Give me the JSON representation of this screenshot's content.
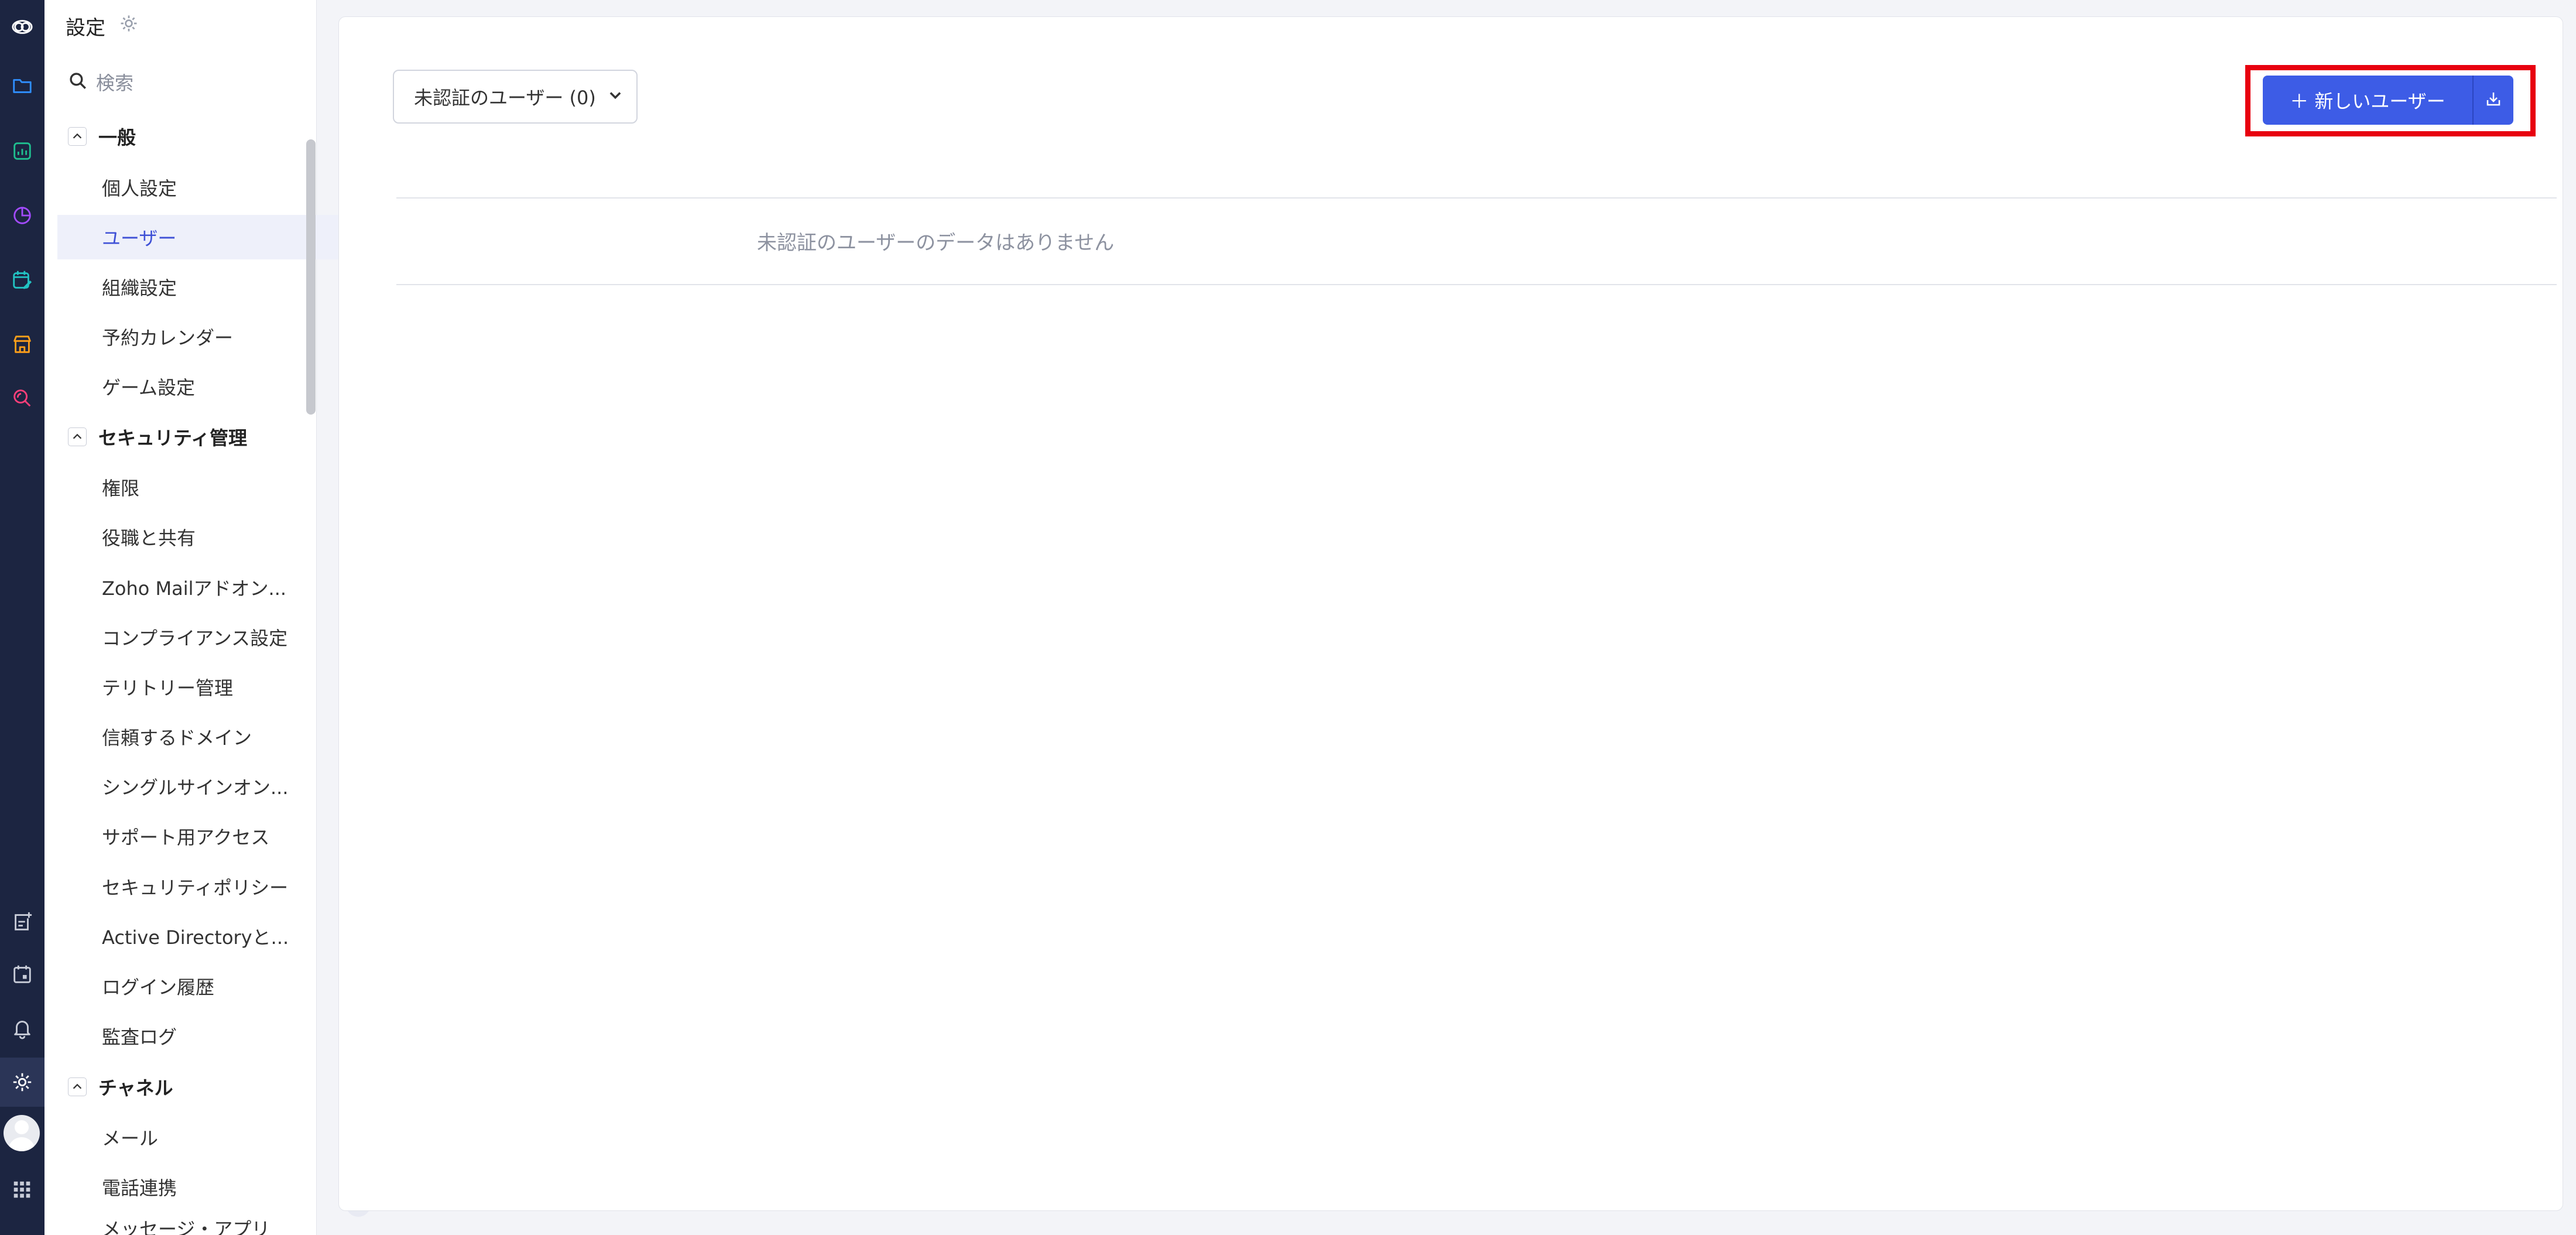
{
  "rail": {
    "items": [
      {
        "name": "zoho-logo-icon",
        "color": "#ffffff"
      },
      {
        "name": "folder-icon",
        "color": "#2f8fff"
      },
      {
        "name": "analytics-icon",
        "color": "#1fbf8f"
      },
      {
        "name": "pie-chart-icon",
        "color": "#a34bff"
      },
      {
        "name": "calendar-edit-icon",
        "color": "#22c3c3"
      },
      {
        "name": "store-icon",
        "color": "#ff9f1a"
      },
      {
        "name": "search-zoom-icon",
        "color": "#ff3f7a"
      },
      {
        "name": "add-note-icon",
        "color": "#c8ccd8"
      },
      {
        "name": "calendar-icon",
        "color": "#c8ccd8"
      },
      {
        "name": "bell-icon",
        "color": "#c8ccd8"
      },
      {
        "name": "gear-icon",
        "color": "#ffffff"
      },
      {
        "name": "apps-grid-icon",
        "color": "#c8ccd8"
      }
    ]
  },
  "sidebar": {
    "title": "設定",
    "search_placeholder": "検索",
    "sections": {
      "general": {
        "label": "一般",
        "items": [
          "個人設定",
          "ユーザー",
          "組織設定",
          "予約カレンダー",
          "ゲーム設定"
        ]
      },
      "security": {
        "label": "セキュリティ管理",
        "items": [
          "権限",
          "役職と共有",
          "Zoho Mailアドオン...",
          "コンプライアンス設定",
          "テリトリー管理",
          "信頼するドメイン",
          "シングルサインオン...",
          "サポート用アクセス",
          "セキュリティポリシー",
          "Active Directoryと...",
          "ログイン履歴",
          "監査ログ"
        ]
      },
      "channels": {
        "label": "チャネル",
        "items": [
          "メール",
          "電話連携",
          "メッセージ・アプリ"
        ]
      }
    }
  },
  "main": {
    "filter_label": "未認証のユーザー (0)",
    "new_user_label": "＋ 新しいユーザー",
    "empty_message": "未認証のユーザーのデータはありません"
  },
  "colors": {
    "rail_bg": "#1c2541",
    "accent": "#3d5ce6",
    "active_text": "#3f51d6",
    "highlight": "#e8000f"
  }
}
